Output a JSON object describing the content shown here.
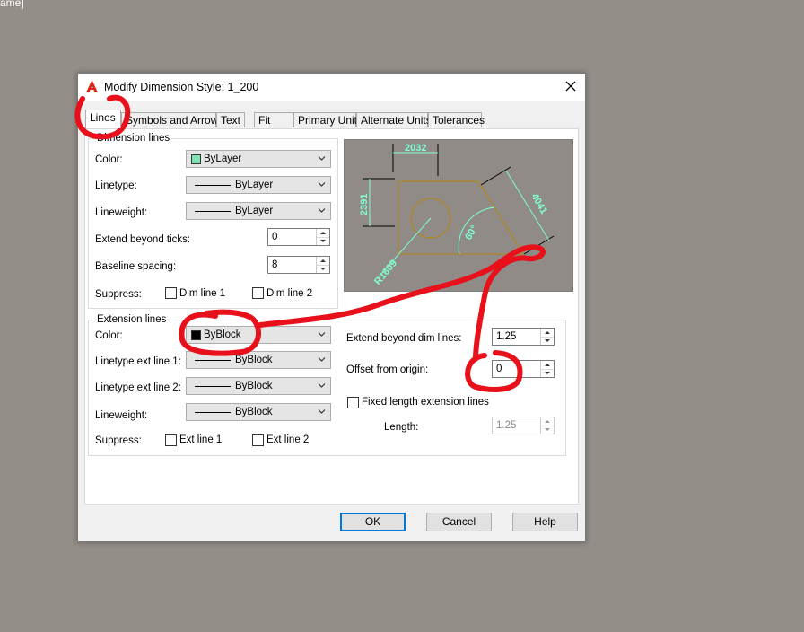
{
  "corner_text": "ame]",
  "dialog": {
    "title": "Modify Dimension Style: 1_200"
  },
  "tabs": [
    "Lines",
    "Symbols and Arrows",
    "Text",
    "Fit",
    "Primary Units",
    "Alternate Units",
    "Tolerances"
  ],
  "dimension_lines": {
    "group_label": "Dimension lines",
    "color_label": "Color:",
    "color_value": "ByLayer",
    "color_swatch": "#7fe3b3",
    "linetype_label": "Linetype:",
    "linetype_value": "ByLayer",
    "lineweight_label": "Lineweight:",
    "lineweight_value": "ByLayer",
    "extend_label": "Extend beyond ticks:",
    "extend_value": "0",
    "baseline_label": "Baseline spacing:",
    "baseline_value": "8",
    "suppress_label": "Suppress:",
    "dim_line_1": "Dim line 1",
    "dim_line_2": "Dim line 2"
  },
  "preview": {
    "dim_top": "2032",
    "dim_left": "2391",
    "dim_diag": "4041",
    "dim_angle": "60°",
    "dim_radius": "R1609",
    "dim_color": "#7fffd4"
  },
  "extension_lines": {
    "group_label": "Extension lines",
    "color_label": "Color:",
    "color_value": "ByBlock",
    "linetype1_label": "Linetype ext line 1:",
    "linetype1_value": "ByBlock",
    "linetype2_label": "Linetype ext line 2:",
    "linetype2_value": "ByBlock",
    "lineweight_label": "Lineweight:",
    "lineweight_value": "ByBlock",
    "suppress_label": "Suppress:",
    "ext_line_1": "Ext line 1",
    "ext_line_2": "Ext line 2",
    "extend_label": "Extend beyond dim lines:",
    "extend_value": "1.25",
    "offset_label": "Offset from origin:",
    "offset_value": "0",
    "fixed_label": "Fixed length extension lines",
    "length_label": "Length:",
    "length_value": "1.25"
  },
  "buttons": {
    "ok": "OK",
    "cancel": "Cancel",
    "help": "Help"
  },
  "annotation_color": "#e8101a"
}
